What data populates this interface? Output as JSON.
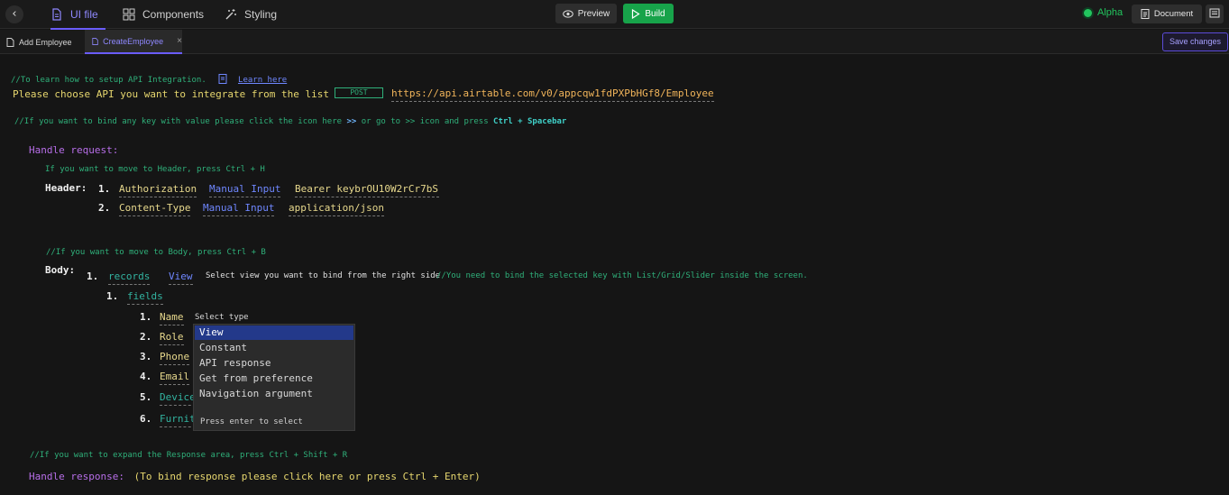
{
  "topbar": {
    "back_icon": "chevron-left-icon",
    "tabs": [
      {
        "label": "UI file",
        "icon": "file-icon"
      },
      {
        "label": "Components",
        "icon": "grid-icon"
      },
      {
        "label": "Styling",
        "icon": "magic-wand-icon"
      }
    ],
    "preview_label": "Preview",
    "build_label": "Build",
    "alpha_label": "Alpha",
    "document_label": "Document",
    "accent": "#6a5cff",
    "build_color": "#17a34a"
  },
  "file_tabs": {
    "tabs": [
      {
        "label": "Add Employee"
      },
      {
        "label": "CreateEmployee"
      }
    ],
    "save_label": "Save changes"
  },
  "editor": {
    "api_comment": "//To learn how to setup API Integration.",
    "learn_here": "Learn here",
    "choose_api": "Please choose API you want to integrate from the list",
    "method": "POST",
    "url": "https://api.airtable.com/v0/appcqw1fdPXPbHGf8/Employee",
    "bind_comment_1": "//If you want to bind any key with value please click the icon here",
    "bind_arrow": ">>",
    "bind_comment_2": "or go to >> icon and press",
    "bind_shortcut": "Ctrl + Spacebar",
    "handle_request": "Handle request:",
    "header_comment": "If you want to move to Header, press Ctrl + H",
    "header_label": "Header:",
    "headers": [
      {
        "num": "1.",
        "key": "Authorization",
        "type": "Manual Input",
        "value": "Bearer keybrOU10W2rCr7bS"
      },
      {
        "num": "2.",
        "key": "Content-Type",
        "type": "Manual Input",
        "value": "application/json"
      }
    ],
    "body_comment": "//If you want to move to Body, press Ctrl + B",
    "body_label": "Body:",
    "body_num": "1.",
    "records_key": "records",
    "records_type": "View",
    "records_hint": "Select view you want to bind from the right side",
    "records_comment": "//You need to bind the selected key with List/Grid/Slider inside the screen.",
    "fields_num": "1.",
    "fields_key": "fields",
    "fields": [
      {
        "num": "1.",
        "key": "Name"
      },
      {
        "num": "2.",
        "key": "Role"
      },
      {
        "num": "3.",
        "key": "Phone"
      },
      {
        "num": "4.",
        "key": "Email"
      },
      {
        "num": "5.",
        "key": "Device"
      },
      {
        "num": "6.",
        "key": "Furnit"
      }
    ],
    "select_type_label": "Select type",
    "dropdown_options": [
      "View",
      "Constant",
      "API response",
      "Get from preference",
      "Navigation argument"
    ],
    "dropdown_selected": "View",
    "dropdown_hint": "Press enter to select",
    "response_comment": "//If you want to expand the Response area, press Ctrl + Shift + R",
    "handle_response": "Handle response:",
    "response_hint": "(To bind response please click here or press Ctrl + Enter)"
  }
}
